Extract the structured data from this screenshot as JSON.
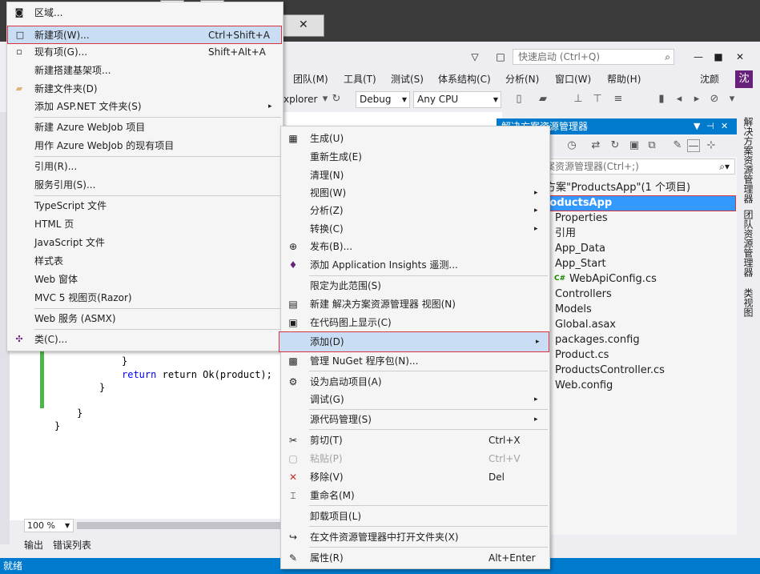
{
  "window": {
    "quick_launch_placeholder": "快速启动 (Ctrl+Q)",
    "user_name": "沈颜",
    "avatar_letter": "沈"
  },
  "menubar": [
    {
      "label": "团队(M)"
    },
    {
      "label": "工具(T)"
    },
    {
      "label": "测试(S)"
    },
    {
      "label": "体系结构(C)"
    },
    {
      "label": "分析(N)"
    },
    {
      "label": "窗口(W)"
    },
    {
      "label": "帮助(H)"
    }
  ],
  "toolbar": {
    "browser_label": "xplorer",
    "config": "Debug",
    "platform": "Any CPU"
  },
  "editor": {
    "zoom": "100 %",
    "lines": {
      "l1": "return Ok(product);"
    }
  },
  "bottom_tabs": [
    "输出",
    "错误列表"
  ],
  "status": "就绪",
  "solution_explorer": {
    "title": "解决方案资源管理器",
    "search_placeholder": "案资源管理器(Ctrl+;)",
    "solution_label": "方案\"ProductsApp\"(1 个项目)",
    "project": "roductsApp",
    "items": [
      "Properties",
      "引用",
      "App_Data",
      "App_Start",
      "WebApiConfig.cs",
      "Controllers",
      "Models",
      "Global.asax",
      "packages.config",
      "Product.cs",
      "ProductsController.cs",
      "Web.config"
    ]
  },
  "side_tabs": [
    "解决方案资源管理器",
    "团队资源管理器",
    "类视图"
  ],
  "add_menu": [
    {
      "label": "区域...",
      "shortcut": ""
    },
    {
      "label": "新建项(W)...",
      "shortcut": "Ctrl+Shift+A"
    },
    {
      "label": "现有项(G)...",
      "shortcut": "Shift+Alt+A"
    },
    {
      "label": "新建搭建基架项...",
      "shortcut": ""
    },
    {
      "label": "新建文件夹(D)",
      "shortcut": ""
    },
    {
      "label": "添加 ASP.NET 文件夹(S)",
      "shortcut": ""
    },
    {
      "label": "新建 Azure WebJob 项目",
      "shortcut": ""
    },
    {
      "label": "用作 Azure WebJob 的现有项目",
      "shortcut": ""
    },
    {
      "label": "引用(R)...",
      "shortcut": ""
    },
    {
      "label": "服务引用(S)...",
      "shortcut": ""
    },
    {
      "label": "TypeScript 文件",
      "shortcut": ""
    },
    {
      "label": "HTML 页",
      "shortcut": ""
    },
    {
      "label": "JavaScript 文件",
      "shortcut": ""
    },
    {
      "label": "样式表",
      "shortcut": ""
    },
    {
      "label": "Web 窗体",
      "shortcut": ""
    },
    {
      "label": "MVC 5 视图页(Razor)",
      "shortcut": ""
    },
    {
      "label": "Web 服务 (ASMX)",
      "shortcut": ""
    },
    {
      "label": "类(C)...",
      "shortcut": ""
    }
  ],
  "context_menu": [
    {
      "label": "生成(U)",
      "shortcut": ""
    },
    {
      "label": "重新生成(E)",
      "shortcut": ""
    },
    {
      "label": "清理(N)",
      "shortcut": ""
    },
    {
      "label": "视图(W)",
      "shortcut": ""
    },
    {
      "label": "分析(Z)",
      "shortcut": ""
    },
    {
      "label": "转换(C)",
      "shortcut": ""
    },
    {
      "label": "发布(B)...",
      "shortcut": ""
    },
    {
      "label": "添加 Application Insights 遥测...",
      "shortcut": ""
    },
    {
      "label": "限定为此范围(S)",
      "shortcut": ""
    },
    {
      "label": "新建 解决方案资源管理器 视图(N)",
      "shortcut": ""
    },
    {
      "label": "在代码图上显示(C)",
      "shortcut": ""
    },
    {
      "label": "添加(D)",
      "shortcut": ""
    },
    {
      "label": "管理 NuGet 程序包(N)...",
      "shortcut": ""
    },
    {
      "label": "设为启动项目(A)",
      "shortcut": ""
    },
    {
      "label": "调试(G)",
      "shortcut": ""
    },
    {
      "label": "源代码管理(S)",
      "shortcut": ""
    },
    {
      "label": "剪切(T)",
      "shortcut": "Ctrl+X"
    },
    {
      "label": "粘贴(P)",
      "shortcut": "Ctrl+V"
    },
    {
      "label": "移除(V)",
      "shortcut": "Del"
    },
    {
      "label": "重命名(M)",
      "shortcut": ""
    },
    {
      "label": "卸载项目(L)",
      "shortcut": ""
    },
    {
      "label": "在文件资源管理器中打开文件夹(X)",
      "shortcut": ""
    },
    {
      "label": "属性(R)",
      "shortcut": "Alt+Enter"
    }
  ],
  "colors": {
    "accent": "#007acc",
    "highlight": "#c9def5",
    "outline": "#d9333f"
  }
}
